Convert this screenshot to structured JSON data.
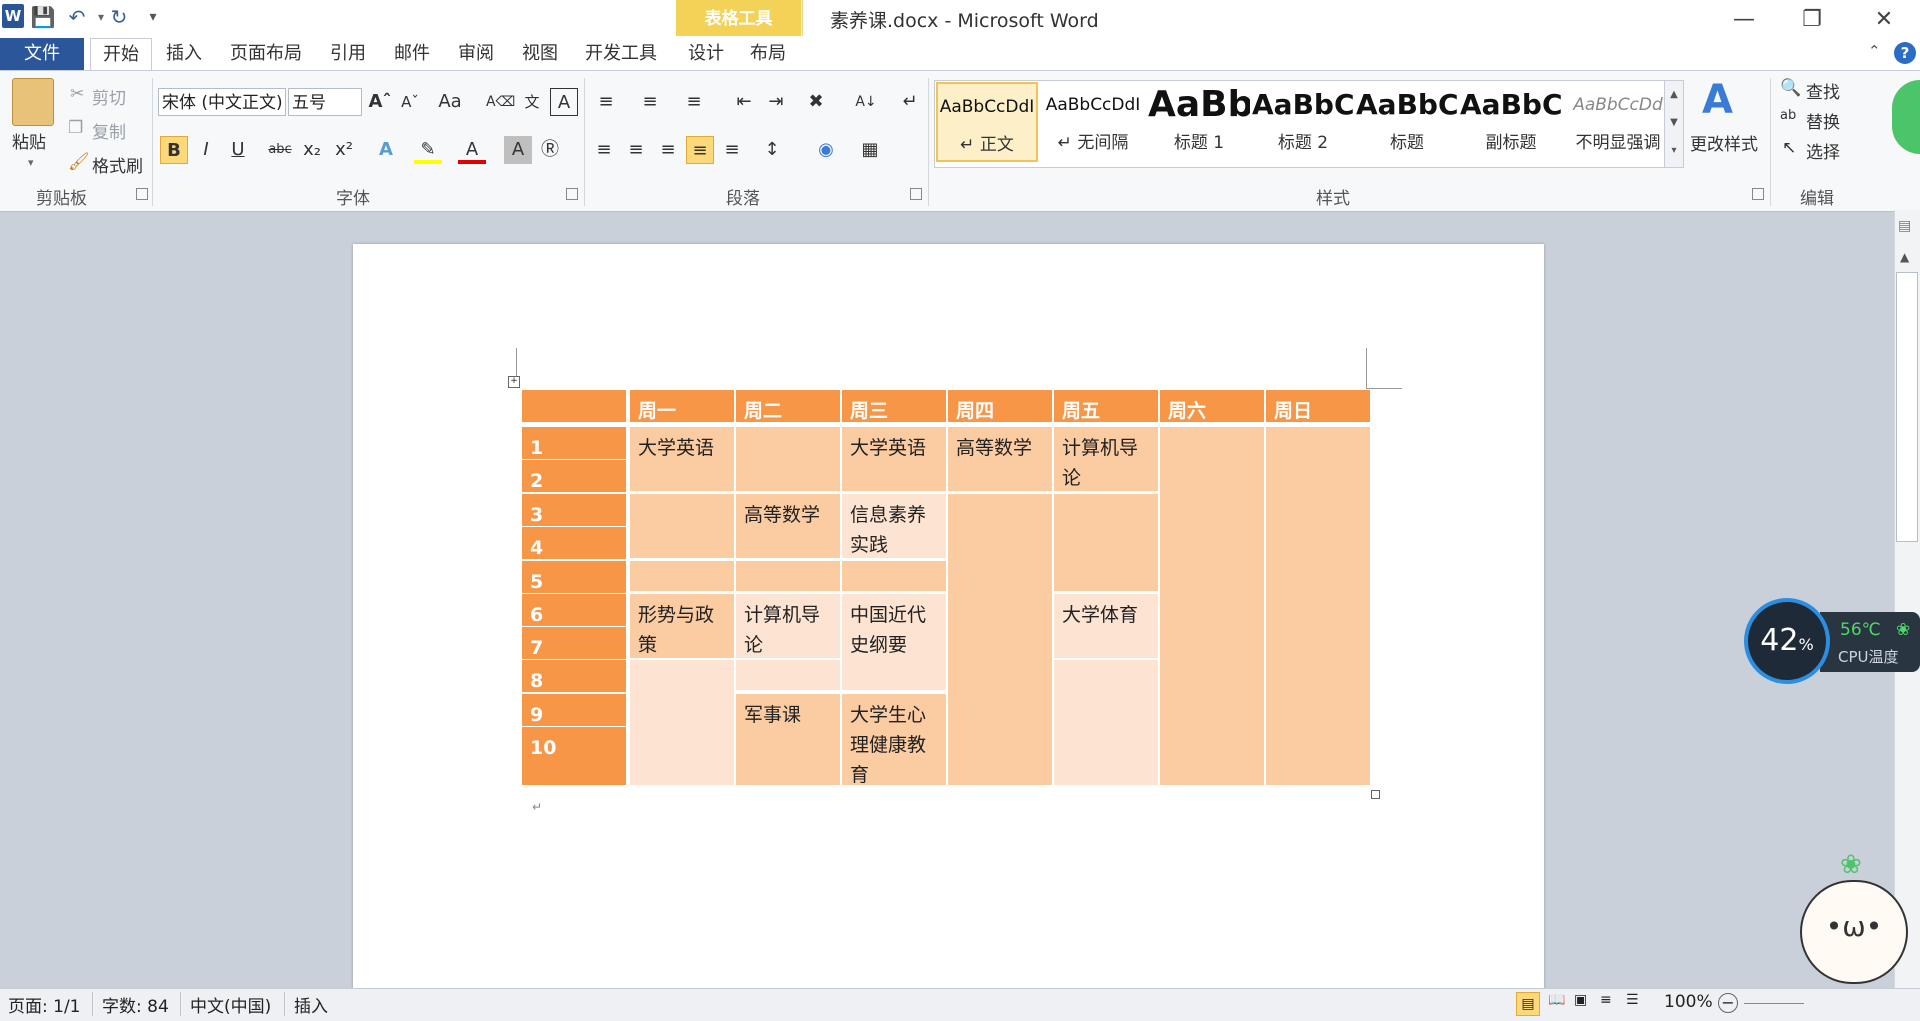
{
  "app": {
    "title": "素养课.docx - Microsoft Word",
    "logo": "W",
    "context_tab_group": "表格工具"
  },
  "tabs": {
    "file": "文件",
    "items": [
      "开始",
      "插入",
      "页面布局",
      "引用",
      "邮件",
      "审阅",
      "视图",
      "开发工具",
      "设计",
      "布局"
    ]
  },
  "ribbon": {
    "clipboard": {
      "paste": "粘贴",
      "cut": "剪切",
      "copy": "复制",
      "format_painter": "格式刷",
      "label": "剪贴板"
    },
    "font": {
      "name": "宋体 (中文正文)",
      "size": "五号",
      "label": "字体"
    },
    "paragraph": {
      "label": "段落"
    },
    "styles": {
      "items": [
        {
          "sample": "AaBbCcDdI",
          "name": "↵ 正文"
        },
        {
          "sample": "AaBbCcDdI",
          "name": "↵ 无间隔"
        },
        {
          "sample": "AaBb",
          "name": "标题 1"
        },
        {
          "sample": "AaBbC",
          "name": "标题 2"
        },
        {
          "sample": "AaBbC",
          "name": "标题"
        },
        {
          "sample": "AaBbC",
          "name": "副标题"
        },
        {
          "sample": "AaBbCcDd",
          "name": "不明显强调"
        }
      ],
      "change": "更改样式",
      "label": "样式"
    },
    "editing": {
      "find": "查找",
      "replace": "替换",
      "select": "选择",
      "label": "编辑"
    }
  },
  "table": {
    "headers": [
      "周一",
      "周二",
      "周三",
      "周四",
      "周五",
      "周六",
      "周日"
    ],
    "rows": [
      "1",
      "2",
      "3",
      "4",
      "5",
      "6",
      "7",
      "8",
      "9",
      "10"
    ],
    "cells": {
      "mon_1": "大学英语",
      "mon_6": "形势与政策",
      "tue_3": "高等数学",
      "tue_6": "计算机导论",
      "tue_9": "军事课",
      "wed_1": "大学英语",
      "wed_3": "信息素养实践",
      "wed_6": "中国近代史纲要",
      "wed_9": "大学生心理健康教育",
      "thu_1": "高等数学",
      "fri_1": "计算机导论",
      "fri_6": "大学体育"
    }
  },
  "status": {
    "page": "页面: 1/1",
    "words": "字数: 84",
    "lang": "中文(中国)",
    "mode": "插入",
    "zoom": "100%"
  },
  "cpu": {
    "percent": "42",
    "percent_sign": "%",
    "temp": "56℃",
    "label": "CPU温度"
  },
  "colors": {
    "header": "#f79646",
    "band_dark": "#fbcba2",
    "band_light": "#fde3d1",
    "file_tab": "#2b579a",
    "context_tab": "#f4d257"
  }
}
